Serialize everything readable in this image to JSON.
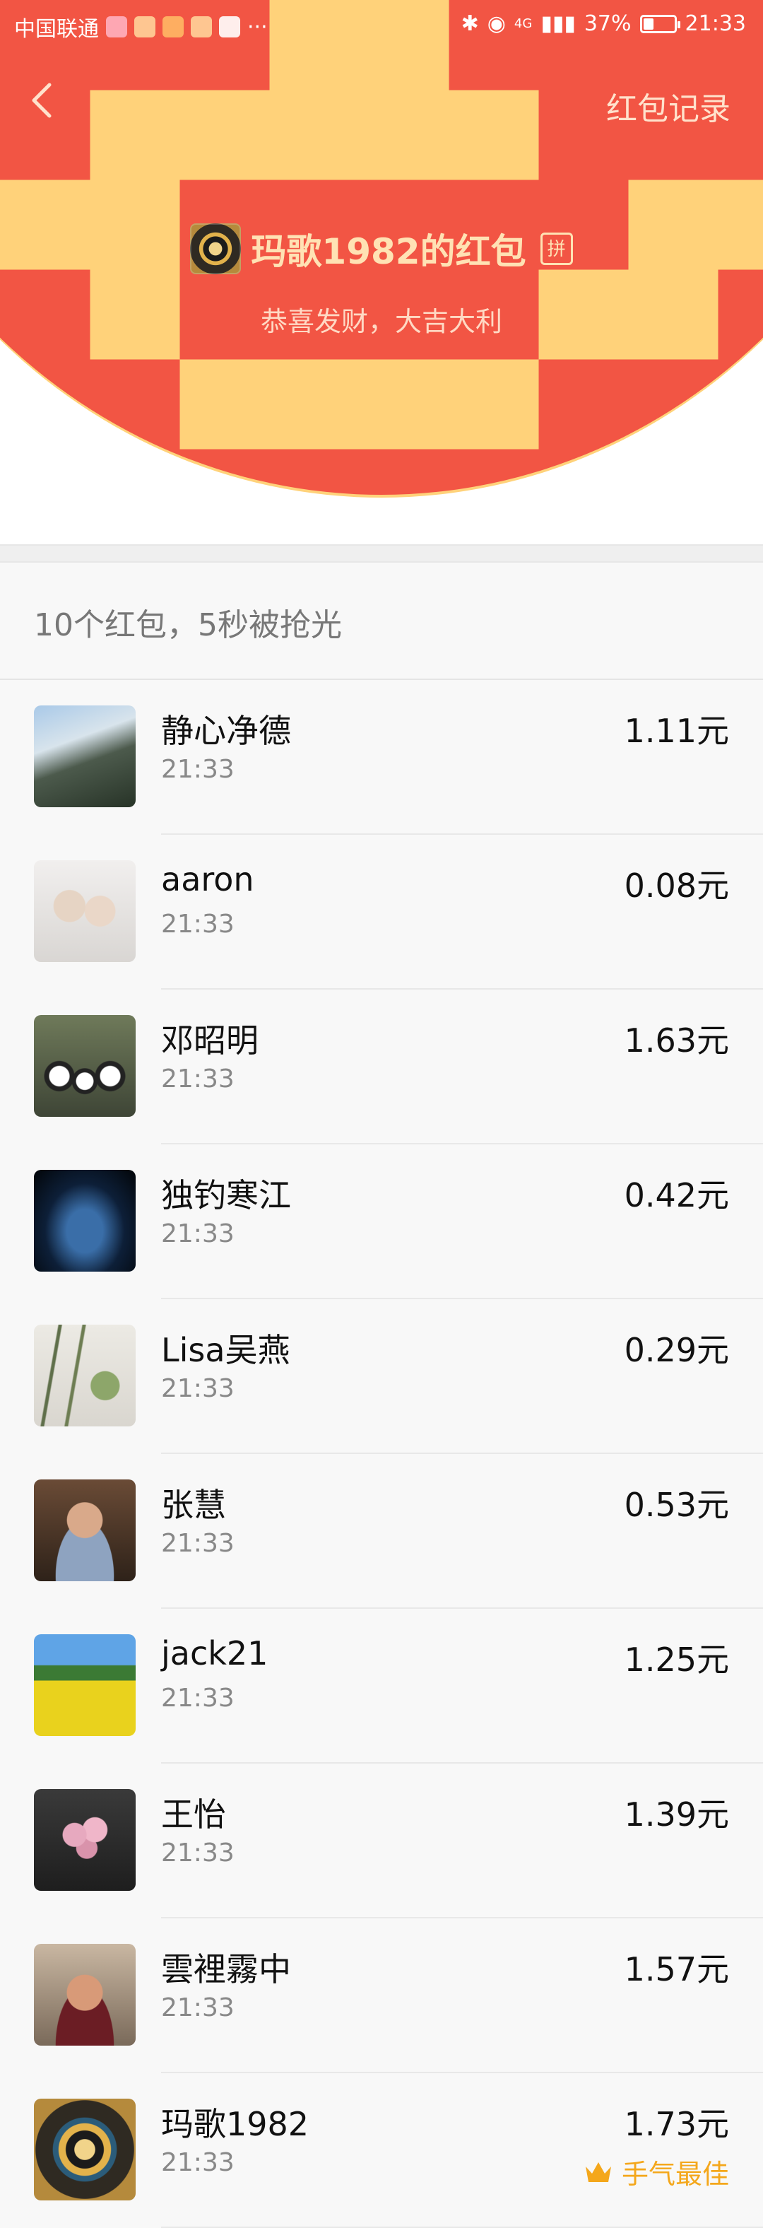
{
  "status_bar": {
    "carrier": "中国联通",
    "dots": "···",
    "network": "4G",
    "battery": "37%",
    "time": "21:33"
  },
  "header": {
    "back_icon": "chevron-left-icon",
    "records_link": "红包记录",
    "sender_name": "玛歌1982的红包",
    "pin_badge": "拼",
    "wish": "恭喜发财，大吉大利"
  },
  "summary": "10个红包，5秒被抢光",
  "rows": [
    {
      "name": "静心净德",
      "time": "21:33",
      "amount": "1.11元",
      "avatar": "mountain-landscape"
    },
    {
      "name": "aaron",
      "time": "21:33",
      "amount": "0.08元",
      "avatar": "two-children"
    },
    {
      "name": "邓昭明",
      "time": "21:33",
      "amount": "1.63元",
      "avatar": "panda-dolls"
    },
    {
      "name": "独钓寒江",
      "time": "21:33",
      "amount": "0.42元",
      "avatar": "night-river"
    },
    {
      "name": "Lisa吴燕",
      "time": "21:33",
      "amount": "0.29元",
      "avatar": "bamboo-painting"
    },
    {
      "name": "张慧",
      "time": "21:33",
      "amount": "0.53元",
      "avatar": "man-portrait"
    },
    {
      "name": "jack21",
      "time": "21:33",
      "amount": "1.25元",
      "avatar": "rapeseed-field"
    },
    {
      "name": "王怡",
      "time": "21:33",
      "amount": "1.39元",
      "avatar": "peony-flowers"
    },
    {
      "name": "雲裡霧中",
      "time": "21:33",
      "amount": "1.57元",
      "avatar": "man-selfie"
    },
    {
      "name": "玛歌1982",
      "time": "21:33",
      "amount": "1.73元",
      "avatar": "mandala-ornament",
      "best_label": "手气最佳"
    }
  ],
  "colors": {
    "header_red": "#f25544",
    "gold_text": "#ffe2b4",
    "best_orange": "#f4a71b"
  }
}
